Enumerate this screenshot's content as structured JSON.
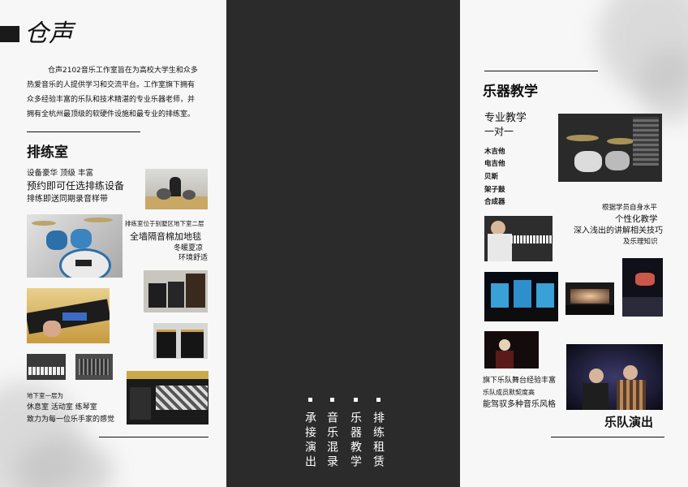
{
  "left": {
    "logo_text": "仓声",
    "intro": [
      "仓声2102音乐工作室旨在为高校大学生和众多",
      "热爱音乐的人提供学习和交流平台。工作室旗下拥有",
      "众多经验丰富的乐队和技术精湛的专业乐器老师，并",
      "拥有全杭州最顶级的软硬件设施和最专业的排练室。"
    ],
    "section_title": "排练室",
    "features_small": "设备豪华 顶级 丰富",
    "features_large": "预约即可任选排练设备",
    "features_record": "排练即送同期录音样带",
    "location": "排练室位于别墅区地下室二层",
    "soundproof": "全墙隔音棉加地毯",
    "climate": "冬暖夏凉",
    "environment": "环境舒适",
    "basement_title": "地下室一层为",
    "basement_rooms": "休息室 活动室 练琴室",
    "basement_slogan": "致力为每一位乐手家的感觉"
  },
  "middle": {
    "columns": [
      "承接演出",
      "音乐混录",
      "乐器教学",
      "排练租赁"
    ]
  },
  "right": {
    "section_title": "乐器教学",
    "pro_teaching": "专业教学",
    "one_on_one": "一对一",
    "instruments": [
      "木吉他",
      "电吉他",
      "贝斯",
      "架子鼓",
      "合成器"
    ],
    "level_note": "根据学员自身水平",
    "personal": "个性化教学",
    "explain": "深入浅出的讲解相关技巧",
    "theory": "及乐理知识",
    "band_stage": "旗下乐队舞台经验丰富",
    "band_members": "乐队成员默契度高",
    "band_styles": "能驾驭多种音乐风格",
    "band_title": "乐队演出"
  },
  "colors": {
    "dark_panel": "#2b2b2b",
    "paper": "#f7f7f7",
    "ink": "#111111"
  }
}
